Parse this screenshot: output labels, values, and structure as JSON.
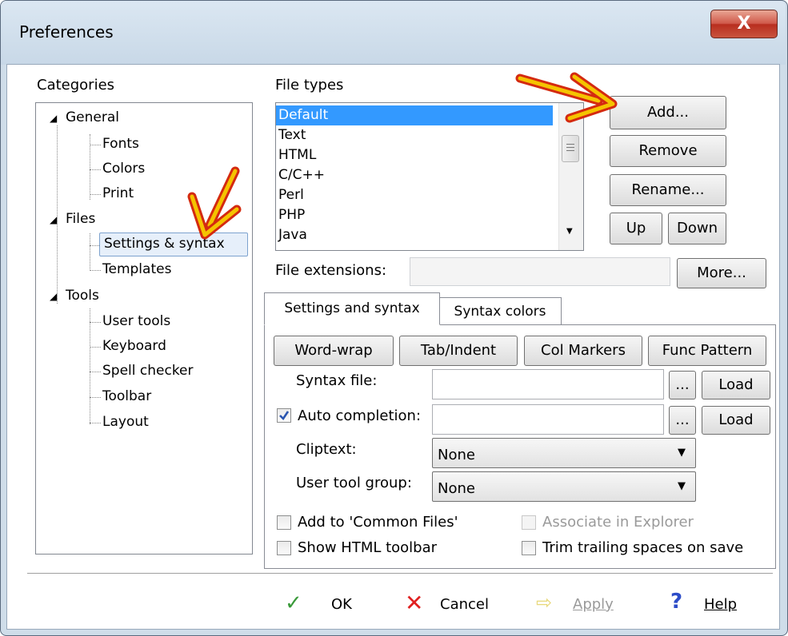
{
  "window": {
    "title": "Preferences",
    "close_label": "X"
  },
  "categories": {
    "label": "Categories",
    "tree": [
      {
        "label": "General",
        "children": [
          "Fonts",
          "Colors",
          "Print"
        ]
      },
      {
        "label": "Files",
        "children": [
          "Settings & syntax",
          "Templates"
        ]
      },
      {
        "label": "Tools",
        "children": [
          "User tools",
          "Keyboard",
          "Spell checker",
          "Toolbar",
          "Layout"
        ]
      }
    ],
    "selected": "Settings & syntax"
  },
  "file_types": {
    "label": "File types",
    "items": [
      "Default",
      "Text",
      "HTML",
      "C/C++",
      "Perl",
      "PHP",
      "Java"
    ],
    "selected": "Default",
    "buttons": {
      "add": "Add...",
      "remove": "Remove",
      "rename": "Rename...",
      "up": "Up",
      "down": "Down"
    }
  },
  "file_extensions": {
    "label": "File extensions:",
    "value": "",
    "more": "More..."
  },
  "tabs": [
    {
      "label": "Settings and syntax",
      "active": true
    },
    {
      "label": "Syntax colors",
      "active": false
    }
  ],
  "settings": {
    "buttons": [
      "Word-wrap",
      "Tab/Indent",
      "Col Markers",
      "Func Pattern"
    ],
    "syntax_file": {
      "label": "Syntax file:",
      "value": "",
      "browse": "...",
      "load": "Load"
    },
    "auto_completion": {
      "label": "Auto completion:",
      "checked": true,
      "value": "",
      "browse": "...",
      "load": "Load"
    },
    "cliptext": {
      "label": "Cliptext:",
      "value": "None"
    },
    "user_tool_group": {
      "label": "User tool group:",
      "value": "None"
    },
    "checkboxes": {
      "common_files": {
        "label": "Add to 'Common Files'",
        "checked": false
      },
      "associate": {
        "label": "Associate in Explorer",
        "checked": false,
        "disabled": true
      },
      "html_toolbar": {
        "label": "Show HTML toolbar",
        "checked": false
      },
      "trim_spaces": {
        "label": "Trim trailing spaces on save",
        "checked": false
      }
    }
  },
  "footer": {
    "ok": "OK",
    "cancel": "Cancel",
    "apply": "Apply",
    "help": "Help"
  },
  "colors": {
    "selection": "#3399ff",
    "arrow_fill": "#f5c400",
    "arrow_outline": "#d42a10"
  }
}
